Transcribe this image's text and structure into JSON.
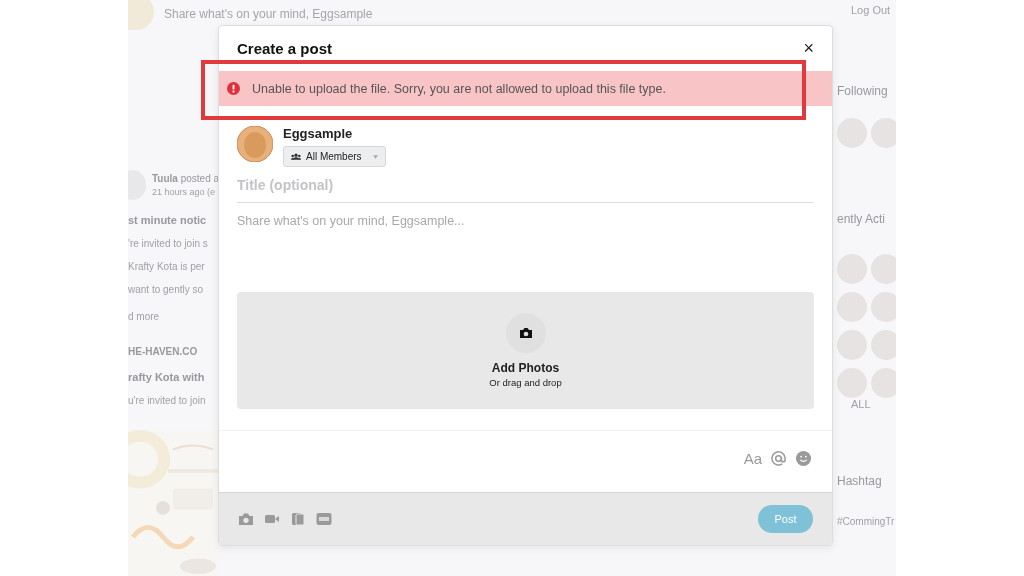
{
  "background": {
    "top_bar": {
      "placeholder": "Share what's on your mind, Eggsample"
    },
    "feed": [
      {
        "kind": "author",
        "name": "Tuula",
        "action": "posted a",
        "time": "21 hours ago (e"
      },
      {
        "kind": "heading",
        "text": "st minute notic"
      },
      {
        "kind": "text",
        "text": "'re invited to join s"
      },
      {
        "kind": "text",
        "text": "Krafty Kota is per"
      },
      {
        "kind": "text",
        "text": "want to gently so"
      },
      {
        "kind": "link",
        "text": "d more"
      },
      {
        "kind": "source",
        "text": "HE-HAVEN.CO"
      },
      {
        "kind": "heading",
        "text": "rafty Kota with"
      },
      {
        "kind": "text",
        "text": "u're invited to join"
      },
      {
        "kind": "picture"
      }
    ],
    "sidebar": {
      "log_out": "Log Out",
      "following_title": "Following",
      "active_title": "ently Acti",
      "see_all": "ALL",
      "hashtags_title": "Hashtag",
      "hashtag": "#CommingTr"
    }
  },
  "modal": {
    "title": "Create a post",
    "close": "×",
    "error": {
      "message": "Unable to upload the file. Sorry, you are not allowed to upload this file type.",
      "highlighted": true
    },
    "author": {
      "name": "Eggsample",
      "audience": "All Members"
    },
    "title_field": {
      "placeholder": "Title (optional)"
    },
    "body_field": {
      "placeholder": "Share what's on your mind, Eggsample..."
    },
    "upload": {
      "label": "Add Photos",
      "hint": "Or drag and drop"
    },
    "format_label": "Aa",
    "post_button": {
      "label": "Post",
      "disabled": true
    }
  }
}
